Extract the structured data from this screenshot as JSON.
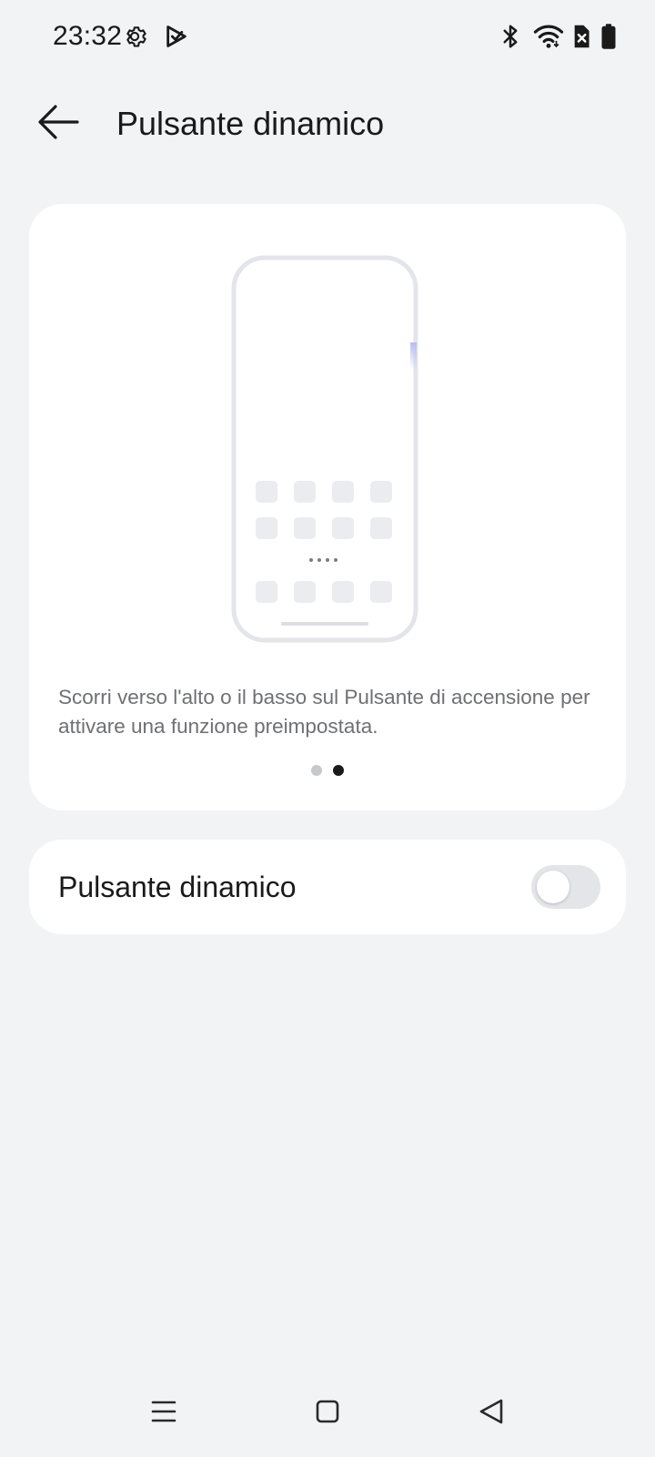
{
  "status_bar": {
    "time": "23:32",
    "left_icons": [
      "gear-icon",
      "play-store-icon"
    ],
    "right_icons": [
      "bluetooth-icon",
      "wifi-icon",
      "no-sim-icon",
      "battery-icon"
    ]
  },
  "header": {
    "title": "Pulsante dinamico"
  },
  "intro": {
    "description": "Scorri verso l'alto o il basso sul Pulsante di accensione per attivare una funzione preimpostata.",
    "pages": 2,
    "active_page": 2
  },
  "setting": {
    "label": "Pulsante dinamico",
    "enabled": false
  },
  "nav_bar": {
    "buttons": [
      "menu-icon",
      "home-icon",
      "back-icon"
    ]
  },
  "colors": {
    "background": "#f2f3f5",
    "card": "#ffffff",
    "accent_edge": "#c3c7f0",
    "toggle_off": "#e4e5e8"
  }
}
